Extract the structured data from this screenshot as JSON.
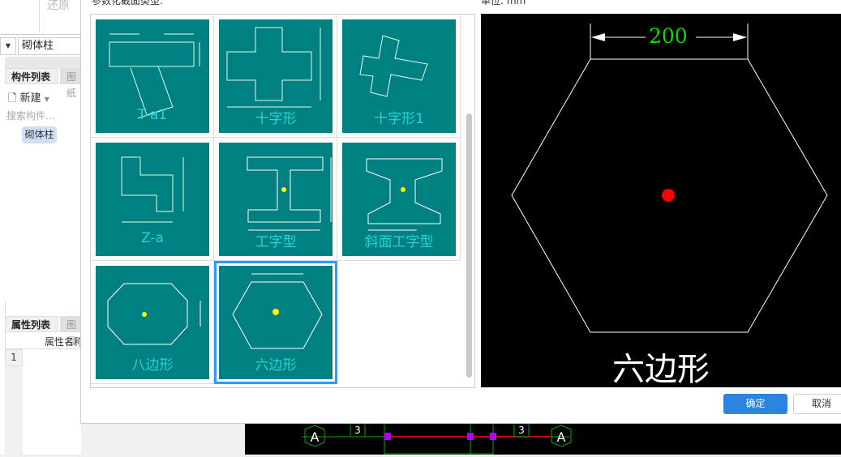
{
  "toolbar": {
    "restore": "还原"
  },
  "left_panel": {
    "dropdown_value": "砌体柱",
    "tabs": [
      "构件列表",
      "图纸"
    ],
    "new_label": "新建",
    "search_placeholder": "搜索构件...",
    "items": [
      "砌体柱"
    ]
  },
  "attr_panel": {
    "tabs": [
      "属性列表",
      "图层"
    ],
    "header": "属性名称",
    "rows": [
      "1"
    ]
  },
  "dialog": {
    "type_label": "参数化截面类型:",
    "unit_label": "单位: mm",
    "sections": [
      {
        "label": "T-a1"
      },
      {
        "label": "十字形"
      },
      {
        "label": "十字形1"
      },
      {
        "label": "Z-a"
      },
      {
        "label": "工字型"
      },
      {
        "label": "斜面工字型"
      },
      {
        "label": "八边形"
      },
      {
        "label": "六边形",
        "selected": true
      }
    ],
    "preview": {
      "dimension": "200",
      "name": "六边形"
    },
    "ok": "确定",
    "cancel": "取消"
  },
  "cad": {
    "axis_label": "A",
    "dim": "3"
  },
  "colors": {
    "thumb_bg": "#008080",
    "caption": "#22d6d6",
    "selection": "#2b9bff",
    "primary": "#2b84e0",
    "dim_text": "#00e000",
    "center": "#ff0000"
  }
}
